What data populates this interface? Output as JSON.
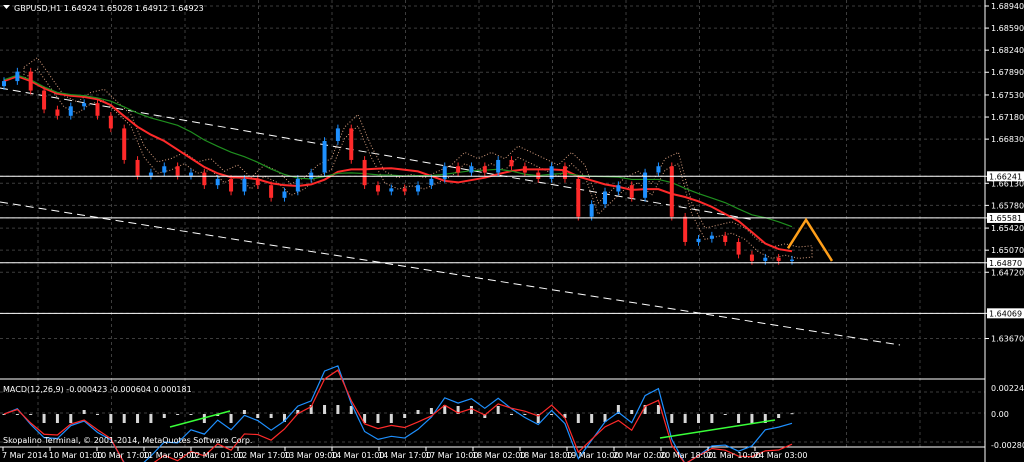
{
  "header": {
    "title": "GBPUSD,H1  1.64924 1.65028 1.64912 1.64923",
    "indicator": "MACD(12,26,9) -0.000423 -0.000604 0.000181",
    "copyright": "Skopalino Terminal, © 2001-2014, MetaQuotes Software Corp."
  },
  "price_axis": [
    {
      "value": "1.68940"
    },
    {
      "value": "1.68590"
    },
    {
      "value": "1.68240"
    },
    {
      "value": "1.67890"
    },
    {
      "value": "1.67530"
    },
    {
      "value": "1.67180"
    },
    {
      "value": "1.66830"
    },
    {
      "value": "1.66241",
      "boxed": true
    },
    {
      "value": "1.66130"
    },
    {
      "value": "1.65780"
    },
    {
      "value": "1.65581",
      "boxed": true
    },
    {
      "value": "1.65420"
    },
    {
      "value": "1.65070"
    },
    {
      "value": "1.64870",
      "boxed": true
    },
    {
      "value": "1.64720"
    },
    {
      "value": "1.64069",
      "boxed": true
    },
    {
      "value": "1.63670"
    }
  ],
  "macd_axis": [
    {
      "value": "0.00224"
    },
    {
      "value": "0.00"
    },
    {
      "value": "-0.00280"
    }
  ],
  "time_axis": [
    "7 Mar 2014",
    "10 Mar 01:00",
    "10 Mar 17:00",
    "11 Mar 09:00",
    "12 Mar 01:00",
    "12 Mar 17:00",
    "13 Mar 09:00",
    "14 Mar 01:00",
    "14 Mar 17:00",
    "17 Mar 10:00",
    "18 Mar 02:00",
    "18 Mar 18:00",
    "19 Mar 10:00",
    "20 Mar 02:00",
    "20 Mar 18:00",
    "21 Mar 10:00",
    "24 Mar 03:00"
  ],
  "colors": {
    "background": "#000000",
    "grid": "#3d3d3d",
    "bull": "#1e90ff",
    "bear": "#ff2a2a",
    "ma_red": "#ff2a2a",
    "ma_green": "#1f8f1f",
    "cloud": "#d9a080",
    "projection": "#ff9f1a",
    "channel": "#ffffff",
    "macd_blue": "#1e90ff",
    "macd_red": "#ff2a2a"
  },
  "chart_data": {
    "type": "candlestick",
    "symbol": "GBPUSD",
    "timeframe": "H1",
    "ohlc_last": {
      "open": 1.64924,
      "high": 1.65028,
      "low": 1.64912,
      "close": 1.64923
    },
    "closes": [
      1.6775,
      1.679,
      1.676,
      1.673,
      1.672,
      1.6735,
      1.674,
      1.672,
      1.67,
      1.665,
      1.6625,
      1.663,
      1.664,
      1.6625,
      1.663,
      1.661,
      1.662,
      1.66,
      1.662,
      1.661,
      1.659,
      1.66,
      1.662,
      1.663,
      1.668,
      1.67,
      1.665,
      1.661,
      1.66,
      1.6605,
      1.66,
      1.661,
      1.662,
      1.664,
      1.663,
      1.664,
      1.663,
      1.665,
      1.664,
      1.663,
      1.662,
      1.664,
      1.662,
      1.656,
      1.658,
      1.66,
      1.661,
      1.659,
      1.663,
      1.664,
      1.656,
      1.652,
      1.6525,
      1.653,
      1.652,
      1.65,
      1.649,
      1.6495,
      1.649,
      1.6492
    ],
    "horizontal_levels": [
      1.66241,
      1.65581,
      1.6487,
      1.64069
    ],
    "projection": [
      1.651,
      1.6555,
      1.649
    ],
    "macd": {
      "main": -0.000423,
      "signal": -0.000604,
      "histogram": 0.000181
    }
  }
}
